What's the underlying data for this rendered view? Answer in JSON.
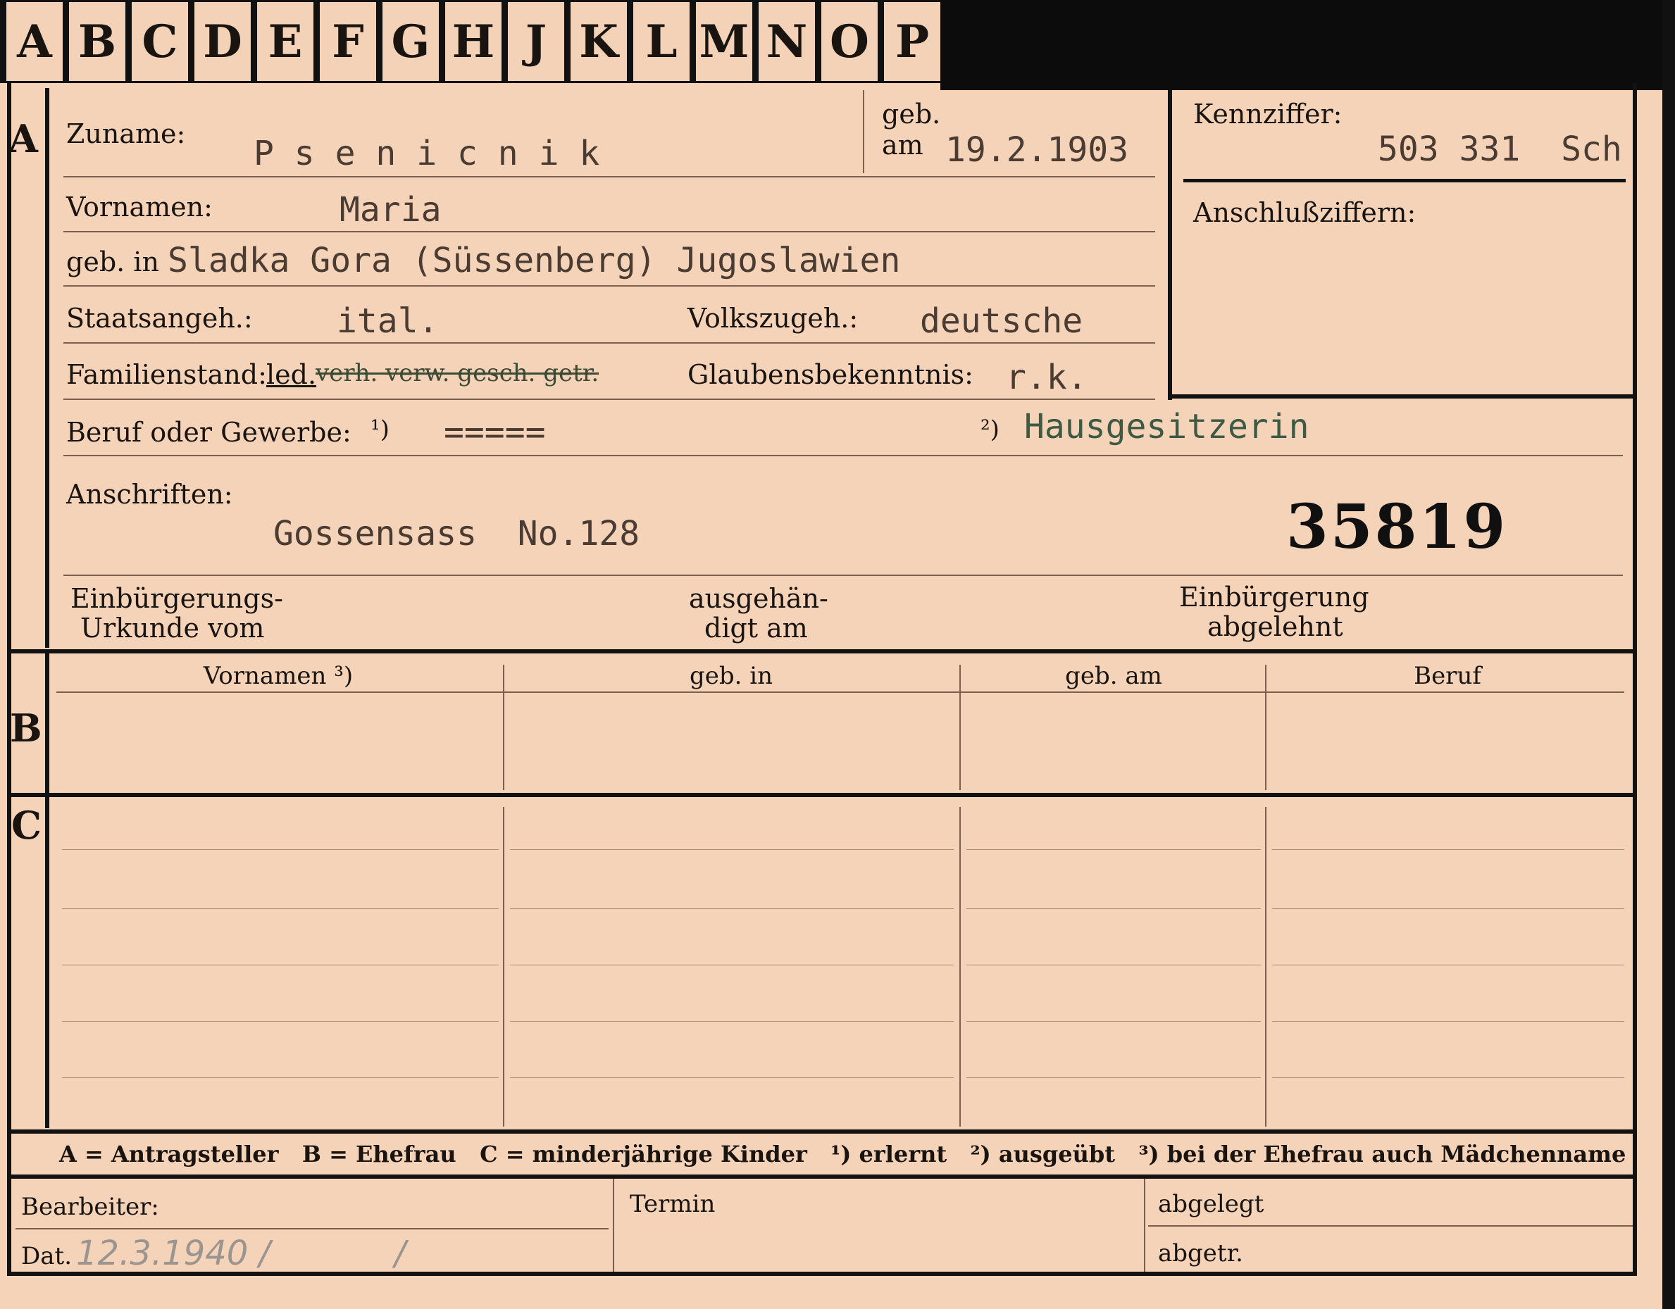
{
  "tabs": [
    "A",
    "B",
    "C",
    "D",
    "E",
    "F",
    "G",
    "H",
    "J",
    "K",
    "L",
    "M",
    "N",
    "O",
    "P"
  ],
  "section_a": {
    "marker": "A",
    "zuname_label": "Zuname:",
    "zuname_value": "P s e n i c n i k",
    "geb_label": "geb.",
    "am_label": "am",
    "geb_am_value": "19.2.1903",
    "vornamen_label": "Vornamen:",
    "vornamen_value": "Maria",
    "geb_in_label": "geb. in",
    "geb_in_value": "Sladka Gora (Süssenberg) Jugoslawien",
    "staatsangeh_label": "Staatsangeh.:",
    "staatsangeh_value": "ital.",
    "volkszugeh_label": "Volkszugeh.:",
    "volkszugeh_value": "deutsche",
    "familienstand_label": "Familienstand:",
    "familienstand_value": "led.",
    "familienstand_struck": "verh. verw. gesch. getr.",
    "glaubens_label": "Glaubensbekenntnis:",
    "glaubens_value": "r.k.",
    "beruf_label": "Beruf oder Gewerbe:",
    "beruf_note1": "¹)",
    "beruf_value1": "=====",
    "beruf_note2": "²)",
    "beruf_value2": "Hausgesitzerin",
    "anschriften_label": "Anschriften:",
    "anschriften_value": "Gossensass  No.128",
    "stamp_number": "35819",
    "einb_label_1": "Einbürgerungs-",
    "einb_label_2": "Urkunde vom",
    "ausgeh_label_1": "ausgehän-",
    "ausgeh_label_2": "digt am",
    "abgelehnt_label_1": "Einbürgerung",
    "abgelehnt_label_2": "abgelehnt"
  },
  "kennziffer": {
    "label": "Kennziffer:",
    "value": "503 331  Sch",
    "anschluss_label": "Anschlußziffern:"
  },
  "section_b": {
    "marker": "B",
    "columns": [
      "Vornamen ³)",
      "geb. in",
      "geb. am",
      "Beruf"
    ]
  },
  "section_c": {
    "marker": "C"
  },
  "legend": "A = Antragsteller   B = Ehefrau   C = minderjährige Kinder   ¹) erlernt   ²) ausgeübt   ³) bei der Ehefrau auch Mädchenname",
  "footer": {
    "bearbeiter_label": "Bearbeiter:",
    "dat_label": "Dat.",
    "dat_value": "12.3.1940 /",
    "dat_extra": "/",
    "termin_label": "Termin",
    "abgelegt_label": "abgelegt",
    "abgetr_label": "abgetr."
  },
  "colors": {
    "card": "#f4d3b8",
    "ink": "#1a1410",
    "typewriter": "#4a3b33",
    "rule": "#7a5e50",
    "border": "#121212"
  }
}
